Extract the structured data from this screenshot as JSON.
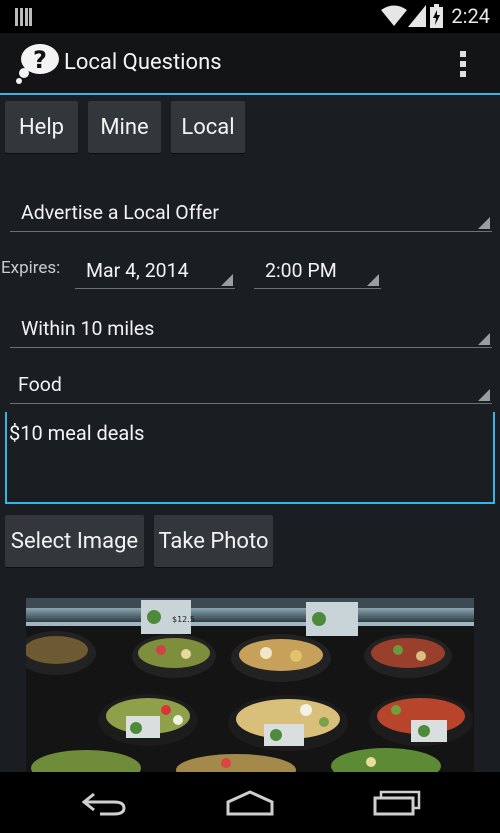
{
  "status_bar": {
    "time": "2:24"
  },
  "app": {
    "title": "Local Questions"
  },
  "tabs": [
    {
      "label": "Help"
    },
    {
      "label": "Mine"
    },
    {
      "label": "Local"
    }
  ],
  "form": {
    "offer_type": "Advertise a Local Offer",
    "expires_label": "Expires:",
    "expires_date": "Mar 4, 2014",
    "expires_time": "2:00 PM",
    "distance": "Within 10 miles",
    "category": "Food",
    "description": "$10 meal deals"
  },
  "image_buttons": {
    "select": "Select Image",
    "take": "Take Photo"
  },
  "photo": {
    "price_tag": "$12.5"
  },
  "colors": {
    "accent": "#33b5e5",
    "background": "#1a1d21",
    "button": "#33373b"
  }
}
